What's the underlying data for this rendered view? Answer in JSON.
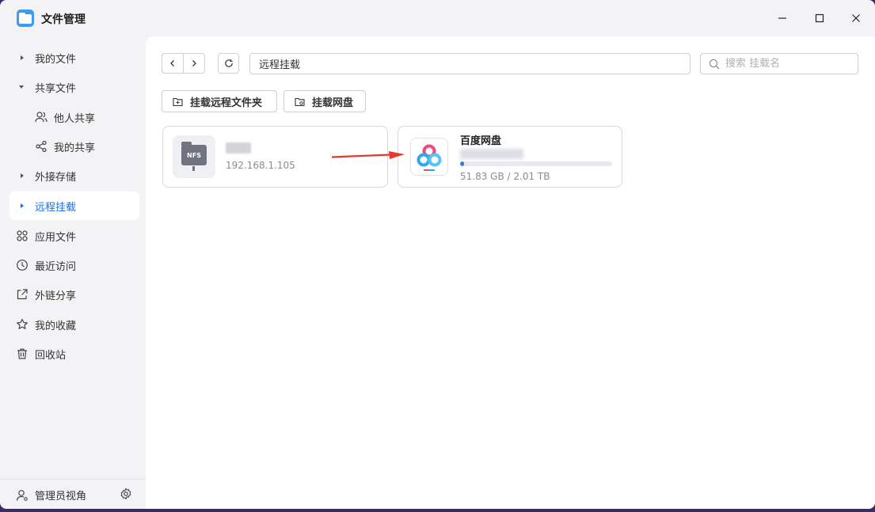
{
  "app": {
    "title": "文件管理"
  },
  "sidebar": {
    "items": [
      {
        "label": "我的文件",
        "kind": "caret"
      },
      {
        "label": "共享文件",
        "kind": "caret-down"
      },
      {
        "label": "他人共享",
        "kind": "sub",
        "icon": "users-icon"
      },
      {
        "label": "我的共享",
        "kind": "sub",
        "icon": "share-icon"
      },
      {
        "label": "外接存储",
        "kind": "caret"
      },
      {
        "label": "远程挂载",
        "kind": "caret",
        "active": true
      },
      {
        "label": "应用文件",
        "icon": "apps-icon"
      },
      {
        "label": "最近访问",
        "icon": "clock-icon"
      },
      {
        "label": "外链分享",
        "icon": "external-share-icon"
      },
      {
        "label": "我的收藏",
        "icon": "star-icon"
      },
      {
        "label": "回收站",
        "icon": "trash-icon"
      }
    ],
    "footer": {
      "label": "管理员视角"
    }
  },
  "toolbar": {
    "path": "远程挂载",
    "search_placeholder": "搜索 挂载名"
  },
  "actions": {
    "mount_remote_folder": "挂载远程文件夹",
    "mount_cloud_drive": "挂载网盘"
  },
  "mounts": [
    {
      "type": "NFS",
      "icon_text": "NFS",
      "address": "192.168.1.105"
    },
    {
      "type": "baidu",
      "title": "百度网盘",
      "usage": "51.83 GB / 2.01 TB",
      "usage_fraction": 0.025
    }
  ],
  "colors": {
    "accent": "#1e6fd9",
    "arrow": "#e8392f"
  }
}
